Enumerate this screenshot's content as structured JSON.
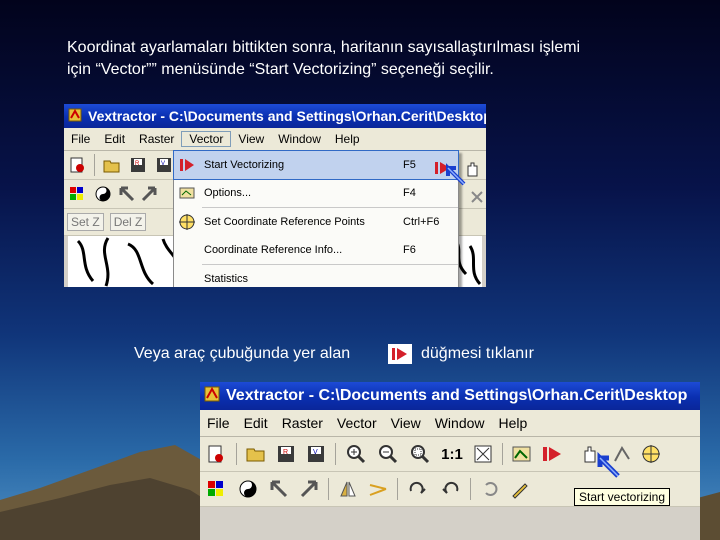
{
  "slide": {
    "intro_line1": "Koordinat ayarlamaları bittikten sonra, haritanın sayısallaştırılması işlemi",
    "intro_line2": "için “Vector”” menüsünde “Start Vectorizing” seçeneği seçilir.",
    "secondary_before": "Veya araç çubuğunda yer alan",
    "secondary_after": "düğmesi tıklanır"
  },
  "screenshot1": {
    "title": "Vextractor - C:\\Documents and Settings\\Orhan.Cerit\\Desktop\\",
    "menu": [
      "File",
      "Edit",
      "Raster",
      "Vector",
      "View",
      "Window",
      "Help"
    ],
    "active_menu": "Vector",
    "setz_label": "Set Z",
    "delz_label": "Del Z",
    "dropdown": [
      {
        "label": "Start Vectorizing",
        "shortcut": "F5",
        "icon": "start-vectorizing-icon",
        "highlight": true
      },
      {
        "label": "Options...",
        "shortcut": "F4",
        "icon": "options-icon",
        "highlight": false
      },
      {
        "label": "Set Coordinate Reference Points",
        "shortcut": "Ctrl+F6",
        "icon": "crosshair-icon",
        "highlight": false
      },
      {
        "label": "Coordinate Reference Info...",
        "shortcut": "F6",
        "icon": "",
        "highlight": false
      },
      {
        "label": "Statistics",
        "shortcut": "",
        "icon": "",
        "highlight": false
      }
    ]
  },
  "screenshot2": {
    "title": "Vextractor - C:\\Documents and Settings\\Orhan.Cerit\\Desktop",
    "menu": [
      "File",
      "Edit",
      "Raster",
      "Vector",
      "View",
      "Window",
      "Help"
    ],
    "zoom_label": "1:1",
    "tooltip": "Start vectorizing"
  },
  "colors": {
    "accent_red": "#d4202a",
    "titlebar_blue": "#0a2fb0",
    "highlight": "#c1d2ee"
  }
}
